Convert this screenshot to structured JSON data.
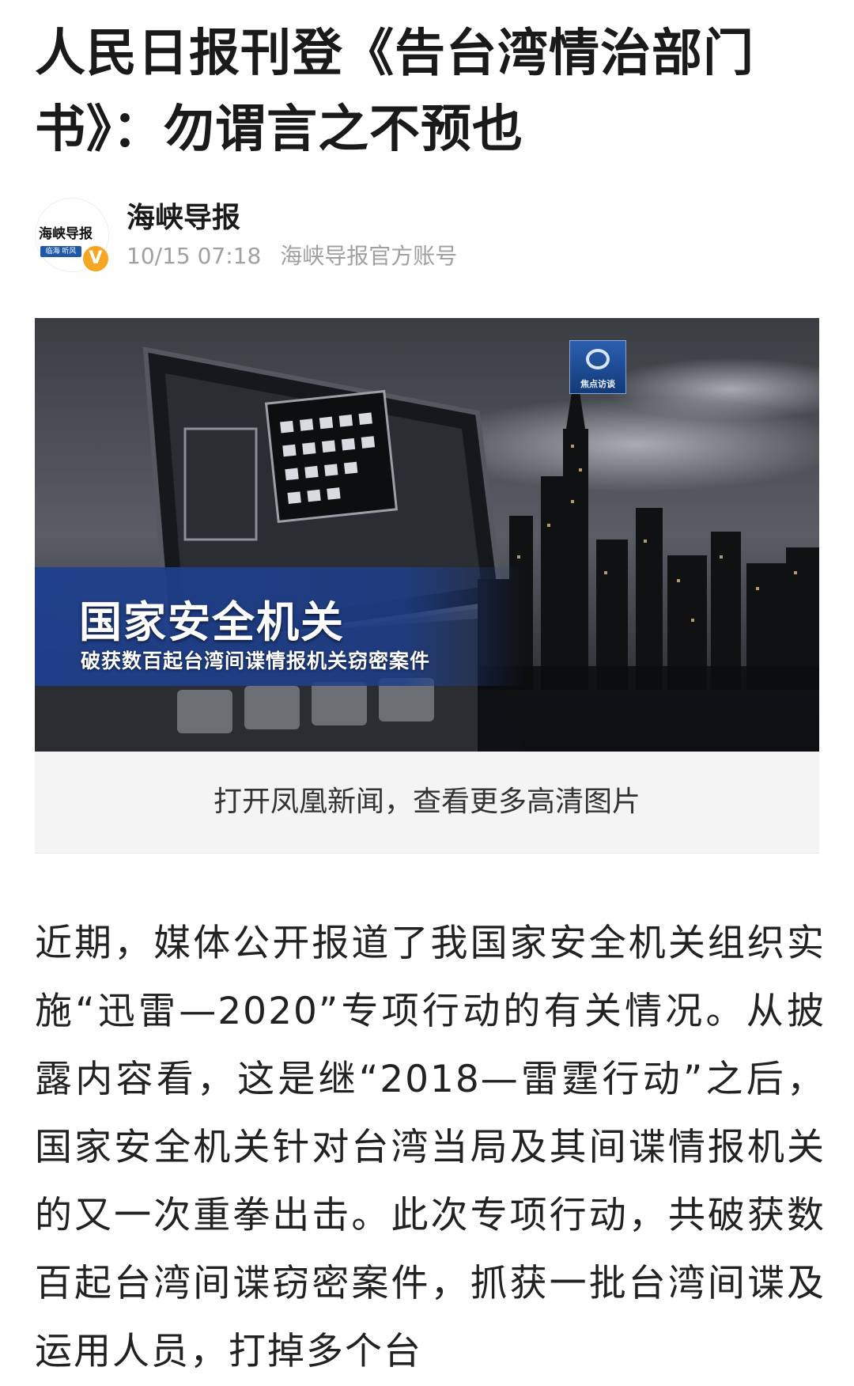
{
  "article": {
    "title": "人民日报刊登《告台湾情治部门书》：勿谓言之不预也",
    "author": {
      "name": "海峡导报",
      "logo_text": "海峡导报",
      "logo_sub": "临海 听风",
      "verified_mark": "V",
      "date": "10/15 07:18",
      "account_type": "海峡导报官方账号"
    },
    "hero_image": {
      "channel_logo_text": "焦点访谈",
      "headline": "国家安全机关",
      "subheadline": "破获数百起台湾间谍情报机关窃密案件"
    },
    "open_app_prompt": "打开凤凰新闻，查看更多高清图片",
    "body": "近期，媒体公开报道了我国家安全机关组织实施“迅雷—2020”专项行动的有关情况。从披露内容看，这是继“2018—雷霆行动”之后，国家安全机关针对台湾当局及其间谍情报机关的又一次重拳出击。此次专项行动，共破获数百起台湾间谍窃密案件，抓获一批台湾间谍及运用人员，打掉多个台"
  },
  "colors": {
    "verified_badge": "#f5a623",
    "banner_blue": "#1e3f8c",
    "muted_text": "#a0a0a0"
  }
}
